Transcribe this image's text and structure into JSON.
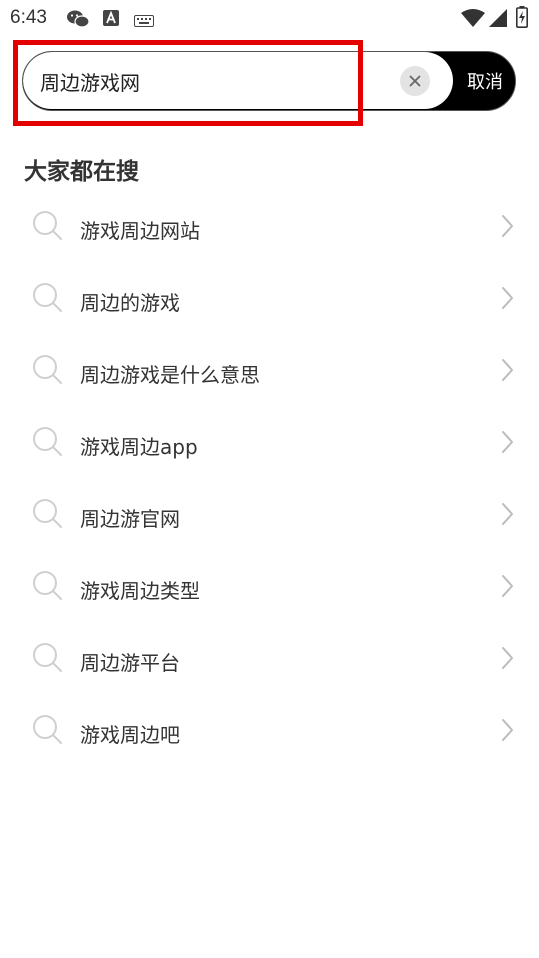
{
  "status_bar": {
    "time": "6:43",
    "left_icons": [
      "wechat-icon",
      "font-a-icon",
      "keyboard-icon"
    ],
    "right_icons": [
      "wifi-icon",
      "signal-icon",
      "battery-charging-icon"
    ]
  },
  "search": {
    "query": "周边游戏网",
    "clear_icon": "close-icon",
    "cancel_label": "取消"
  },
  "section": {
    "title": "大家都在搜"
  },
  "suggestions": [
    {
      "label": "游戏周边网站"
    },
    {
      "label": "周边的游戏"
    },
    {
      "label": "周边游戏是什么意思"
    },
    {
      "label": "游戏周边app"
    },
    {
      "label": "周边游官网"
    },
    {
      "label": "游戏周边类型"
    },
    {
      "label": "周边游平台"
    },
    {
      "label": "游戏周边吧"
    }
  ],
  "colors": {
    "highlight": "#e50000",
    "cancel_bg": "#000000",
    "icon_gray": "#cfcfcf"
  }
}
